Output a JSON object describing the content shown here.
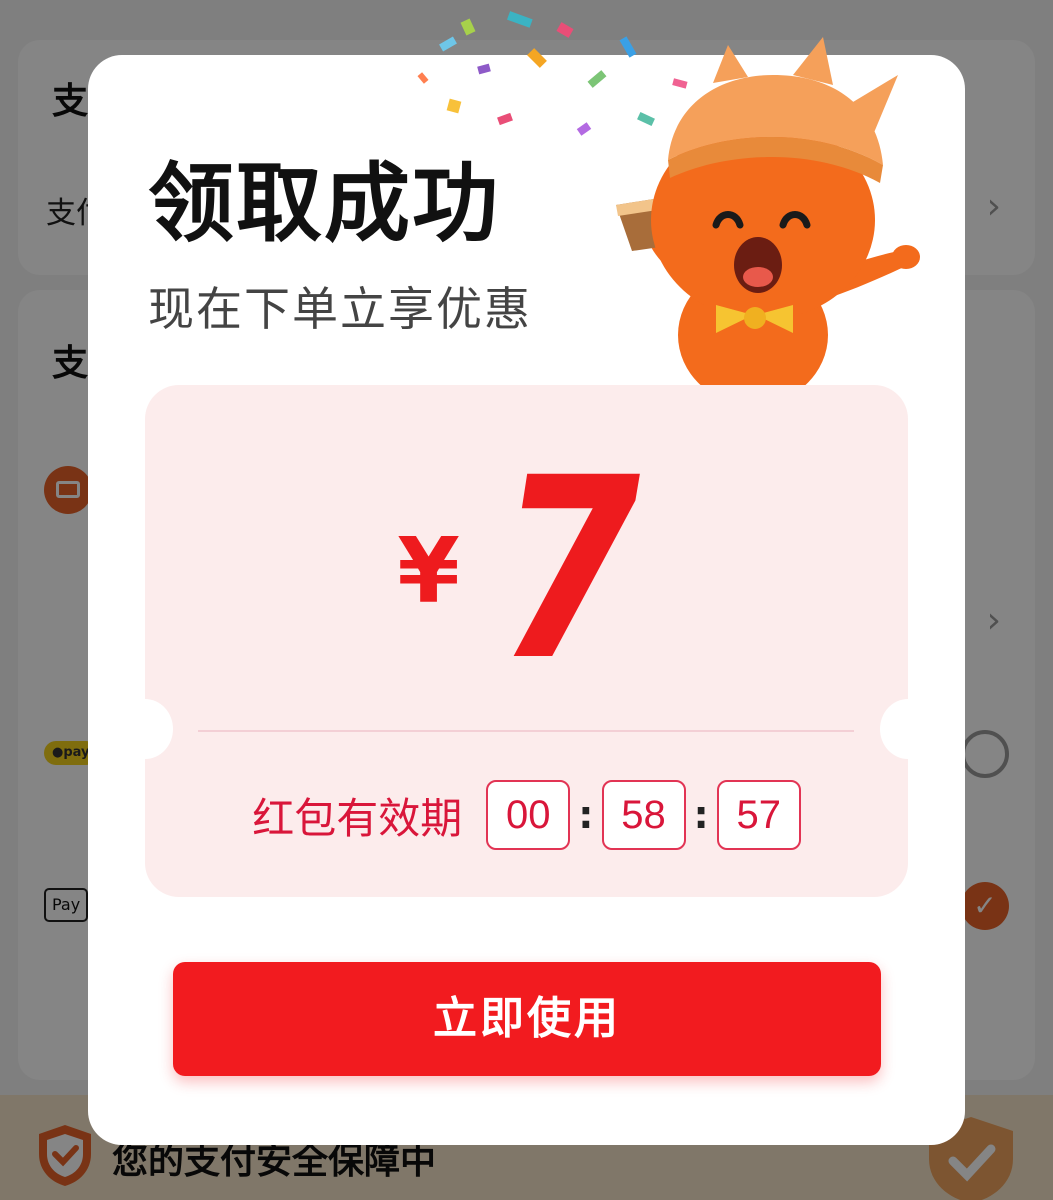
{
  "background": {
    "section1_title": "支",
    "row1_text": "支付",
    "section2_title": "支",
    "pay_badge": "pay",
    "applepay_badge": "Pay",
    "footer_text": "您的支付安全保障中"
  },
  "dialog": {
    "title": "领取成功",
    "subtitle": "现在下单立享优惠"
  },
  "coupon": {
    "currency": "¥",
    "amount": "7",
    "validity_label": "红包有效期",
    "countdown": {
      "hours": "00",
      "minutes": "58",
      "seconds": "57",
      "separator": ":"
    }
  },
  "cta": {
    "label": "立即使用"
  },
  "colors": {
    "accent_red": "#f21b1f",
    "coupon_bg": "#fcecec",
    "brand_orange": "#e8632a"
  },
  "icons": {
    "chevron": "chevron-right-icon",
    "shield": "shield-icon",
    "check": "check-icon"
  }
}
